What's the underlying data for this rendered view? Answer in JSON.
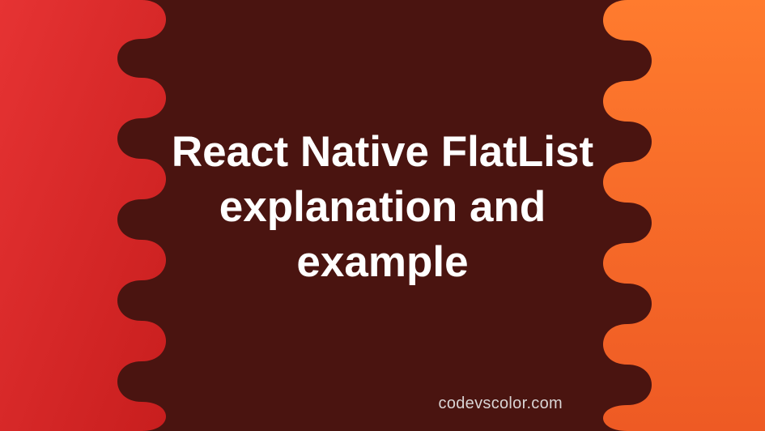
{
  "title": "React Native FlatList explanation and example",
  "watermark": "codevscolor.com",
  "colors": {
    "background": "#4a1410",
    "left_gradient_start": "#e63333",
    "left_gradient_end": "#c81e1e",
    "right_gradient_start": "#ff7b2e",
    "right_gradient_end": "#ee5a24",
    "text": "#ffffff",
    "watermark": "#d9d4d4"
  }
}
